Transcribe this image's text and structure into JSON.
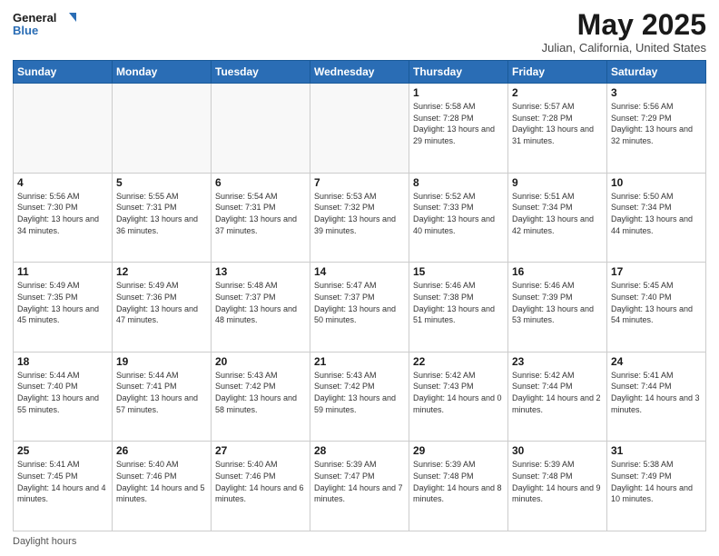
{
  "logo": {
    "line1": "General",
    "line2": "Blue"
  },
  "title": "May 2025",
  "subtitle": "Julian, California, United States",
  "footer": "Daylight hours",
  "weekdays": [
    "Sunday",
    "Monday",
    "Tuesday",
    "Wednesday",
    "Thursday",
    "Friday",
    "Saturday"
  ],
  "weeks": [
    [
      {
        "day": "",
        "info": ""
      },
      {
        "day": "",
        "info": ""
      },
      {
        "day": "",
        "info": ""
      },
      {
        "day": "",
        "info": ""
      },
      {
        "day": "1",
        "info": "Sunrise: 5:58 AM\nSunset: 7:28 PM\nDaylight: 13 hours\nand 29 minutes."
      },
      {
        "day": "2",
        "info": "Sunrise: 5:57 AM\nSunset: 7:28 PM\nDaylight: 13 hours\nand 31 minutes."
      },
      {
        "day": "3",
        "info": "Sunrise: 5:56 AM\nSunset: 7:29 PM\nDaylight: 13 hours\nand 32 minutes."
      }
    ],
    [
      {
        "day": "4",
        "info": "Sunrise: 5:56 AM\nSunset: 7:30 PM\nDaylight: 13 hours\nand 34 minutes."
      },
      {
        "day": "5",
        "info": "Sunrise: 5:55 AM\nSunset: 7:31 PM\nDaylight: 13 hours\nand 36 minutes."
      },
      {
        "day": "6",
        "info": "Sunrise: 5:54 AM\nSunset: 7:31 PM\nDaylight: 13 hours\nand 37 minutes."
      },
      {
        "day": "7",
        "info": "Sunrise: 5:53 AM\nSunset: 7:32 PM\nDaylight: 13 hours\nand 39 minutes."
      },
      {
        "day": "8",
        "info": "Sunrise: 5:52 AM\nSunset: 7:33 PM\nDaylight: 13 hours\nand 40 minutes."
      },
      {
        "day": "9",
        "info": "Sunrise: 5:51 AM\nSunset: 7:34 PM\nDaylight: 13 hours\nand 42 minutes."
      },
      {
        "day": "10",
        "info": "Sunrise: 5:50 AM\nSunset: 7:34 PM\nDaylight: 13 hours\nand 44 minutes."
      }
    ],
    [
      {
        "day": "11",
        "info": "Sunrise: 5:49 AM\nSunset: 7:35 PM\nDaylight: 13 hours\nand 45 minutes."
      },
      {
        "day": "12",
        "info": "Sunrise: 5:49 AM\nSunset: 7:36 PM\nDaylight: 13 hours\nand 47 minutes."
      },
      {
        "day": "13",
        "info": "Sunrise: 5:48 AM\nSunset: 7:37 PM\nDaylight: 13 hours\nand 48 minutes."
      },
      {
        "day": "14",
        "info": "Sunrise: 5:47 AM\nSunset: 7:37 PM\nDaylight: 13 hours\nand 50 minutes."
      },
      {
        "day": "15",
        "info": "Sunrise: 5:46 AM\nSunset: 7:38 PM\nDaylight: 13 hours\nand 51 minutes."
      },
      {
        "day": "16",
        "info": "Sunrise: 5:46 AM\nSunset: 7:39 PM\nDaylight: 13 hours\nand 53 minutes."
      },
      {
        "day": "17",
        "info": "Sunrise: 5:45 AM\nSunset: 7:40 PM\nDaylight: 13 hours\nand 54 minutes."
      }
    ],
    [
      {
        "day": "18",
        "info": "Sunrise: 5:44 AM\nSunset: 7:40 PM\nDaylight: 13 hours\nand 55 minutes."
      },
      {
        "day": "19",
        "info": "Sunrise: 5:44 AM\nSunset: 7:41 PM\nDaylight: 13 hours\nand 57 minutes."
      },
      {
        "day": "20",
        "info": "Sunrise: 5:43 AM\nSunset: 7:42 PM\nDaylight: 13 hours\nand 58 minutes."
      },
      {
        "day": "21",
        "info": "Sunrise: 5:43 AM\nSunset: 7:42 PM\nDaylight: 13 hours\nand 59 minutes."
      },
      {
        "day": "22",
        "info": "Sunrise: 5:42 AM\nSunset: 7:43 PM\nDaylight: 14 hours\nand 0 minutes."
      },
      {
        "day": "23",
        "info": "Sunrise: 5:42 AM\nSunset: 7:44 PM\nDaylight: 14 hours\nand 2 minutes."
      },
      {
        "day": "24",
        "info": "Sunrise: 5:41 AM\nSunset: 7:44 PM\nDaylight: 14 hours\nand 3 minutes."
      }
    ],
    [
      {
        "day": "25",
        "info": "Sunrise: 5:41 AM\nSunset: 7:45 PM\nDaylight: 14 hours\nand 4 minutes."
      },
      {
        "day": "26",
        "info": "Sunrise: 5:40 AM\nSunset: 7:46 PM\nDaylight: 14 hours\nand 5 minutes."
      },
      {
        "day": "27",
        "info": "Sunrise: 5:40 AM\nSunset: 7:46 PM\nDaylight: 14 hours\nand 6 minutes."
      },
      {
        "day": "28",
        "info": "Sunrise: 5:39 AM\nSunset: 7:47 PM\nDaylight: 14 hours\nand 7 minutes."
      },
      {
        "day": "29",
        "info": "Sunrise: 5:39 AM\nSunset: 7:48 PM\nDaylight: 14 hours\nand 8 minutes."
      },
      {
        "day": "30",
        "info": "Sunrise: 5:39 AM\nSunset: 7:48 PM\nDaylight: 14 hours\nand 9 minutes."
      },
      {
        "day": "31",
        "info": "Sunrise: 5:38 AM\nSunset: 7:49 PM\nDaylight: 14 hours\nand 10 minutes."
      }
    ]
  ]
}
